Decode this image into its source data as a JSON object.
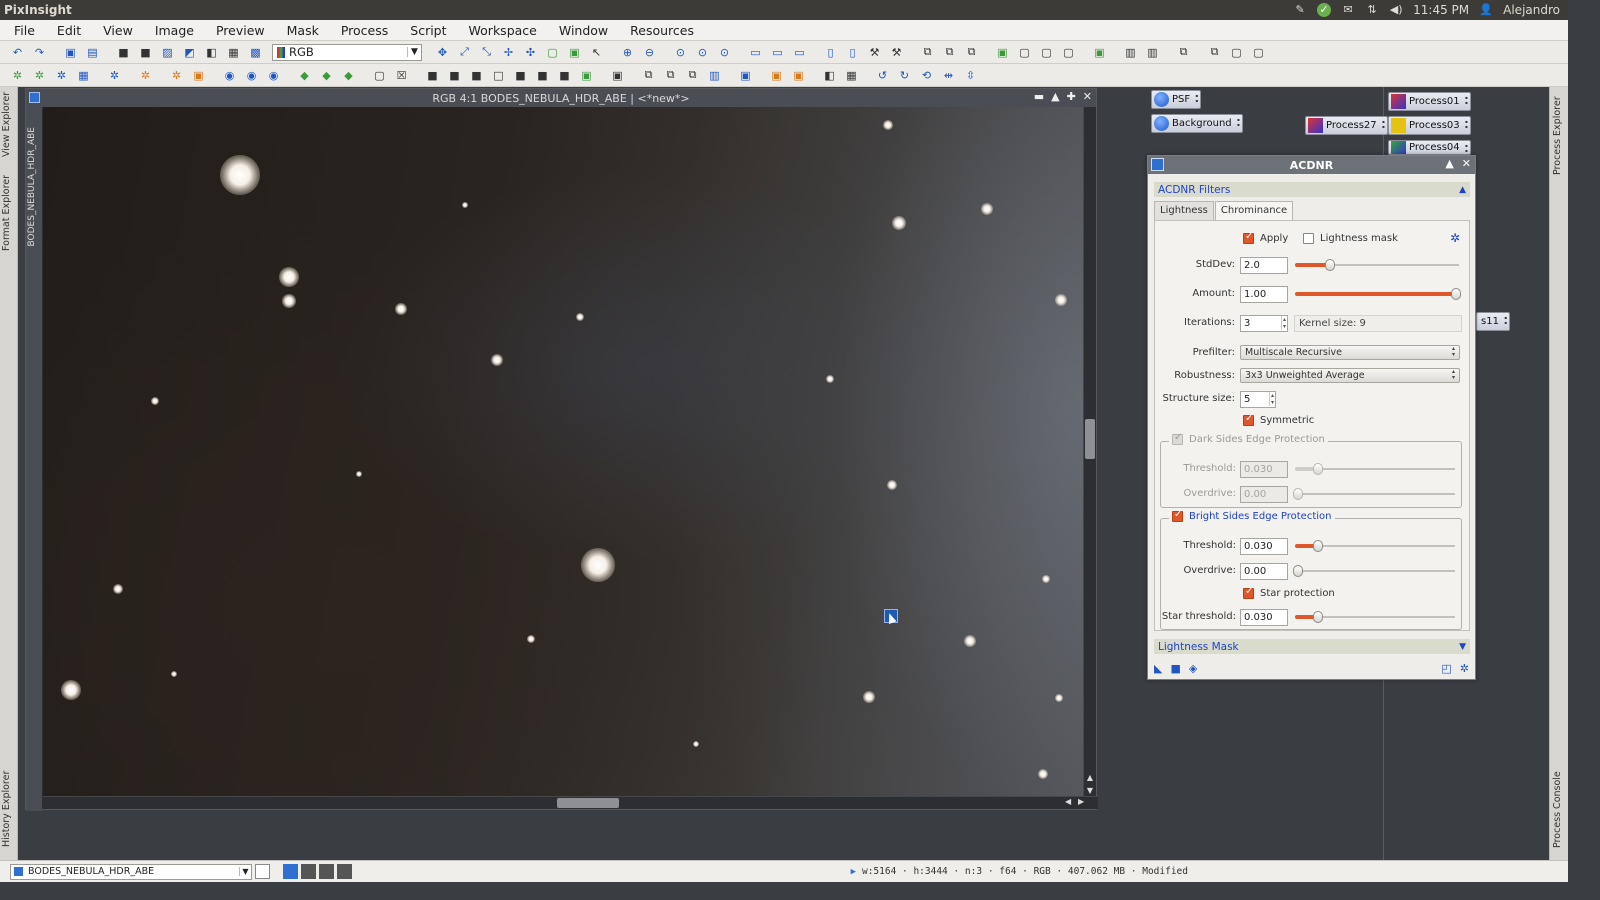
{
  "os": {
    "app_name": "PixInsight",
    "clock": "11:45 PM",
    "user": "Alejandro",
    "icons": [
      "notes-icon",
      "shield-icon",
      "mail-icon",
      "network-icon",
      "volume-icon",
      "user-icon"
    ]
  },
  "menu": [
    "File",
    "Edit",
    "View",
    "Image",
    "Preview",
    "Mask",
    "Process",
    "Script",
    "Workspace",
    "Window",
    "Resources"
  ],
  "toolbar": {
    "channel_select": "RGB"
  },
  "sidebar_left": {
    "tabs": [
      "View Explorer",
      "Format Explorer",
      "History Explorer"
    ]
  },
  "sidebar_right": {
    "tabs": [
      "Process Explorer",
      "Process Console"
    ]
  },
  "image_window": {
    "title": "RGB 4:1 BODES_NEBULA_HDR_ABE | <*new*>",
    "side_label": "BODES_NEBULA_HDR_ABE"
  },
  "process_icons": [
    {
      "label": "PSF",
      "kind": "round"
    },
    {
      "label": "Background",
      "kind": "round"
    },
    {
      "label": "Process27",
      "kind": "square"
    },
    {
      "label": "Process01",
      "kind": "square"
    },
    {
      "label": "Process03",
      "kind": "yellow"
    },
    {
      "label": "Process04",
      "kind": "green"
    },
    {
      "label": "s11",
      "kind": "partial"
    }
  ],
  "acdnr": {
    "title": "ACDNR",
    "filters_section": "ACDNR Filters",
    "tabs": [
      "Lightness",
      "Chrominance"
    ],
    "active_tab": "Chrominance",
    "apply_label": "Apply",
    "apply_checked": true,
    "lightness_mask_label": "Lightness mask",
    "lightness_mask_checked": false,
    "stddev_label": "StdDev:",
    "stddev": "2.0",
    "stddev_slider": 0.2,
    "amount_label": "Amount:",
    "amount": "1.00",
    "amount_slider": 1.0,
    "iterations_label": "Iterations:",
    "iterations": "3",
    "kernel_size": "Kernel size: 9",
    "prefilter_label": "Prefilter:",
    "prefilter": "Multiscale Recursive",
    "robustness_label": "Robustness:",
    "robustness": "3x3 Unweighted Average",
    "structure_size_label": "Structure size:",
    "structure_size": "5",
    "symmetric_label": "Symmetric",
    "symmetric_checked": true,
    "dark_sides": {
      "label": "Dark Sides Edge Protection",
      "enabled": false,
      "threshold_label": "Threshold:",
      "threshold": "0.030",
      "threshold_slider": 0.13,
      "overdrive_label": "Overdrive:",
      "overdrive": "0.00",
      "overdrive_slider": 0.0
    },
    "bright_sides": {
      "label": "Bright Sides Edge Protection",
      "checked": true,
      "threshold_label": "Threshold:",
      "threshold": "0.030",
      "threshold_slider": 0.13,
      "overdrive_label": "Overdrive:",
      "overdrive": "0.00",
      "overdrive_slider": 0.0,
      "star_protection_label": "Star protection",
      "star_protection_checked": true,
      "star_threshold_label": "Star threshold:",
      "star_threshold": "0.030",
      "star_threshold_slider": 0.13
    },
    "lightness_mask_section": "Lightness Mask"
  },
  "statusbar": {
    "view": "BODES_NEBULA_HDR_ABE",
    "info": "w:5164 · h:3444 · n:3 · f64 · RGB · 407.062 MB · Modified"
  },
  "colors": {
    "accent": "#e0572b",
    "link_blue": "#1f42c8",
    "titlebar": "#6d7178"
  }
}
